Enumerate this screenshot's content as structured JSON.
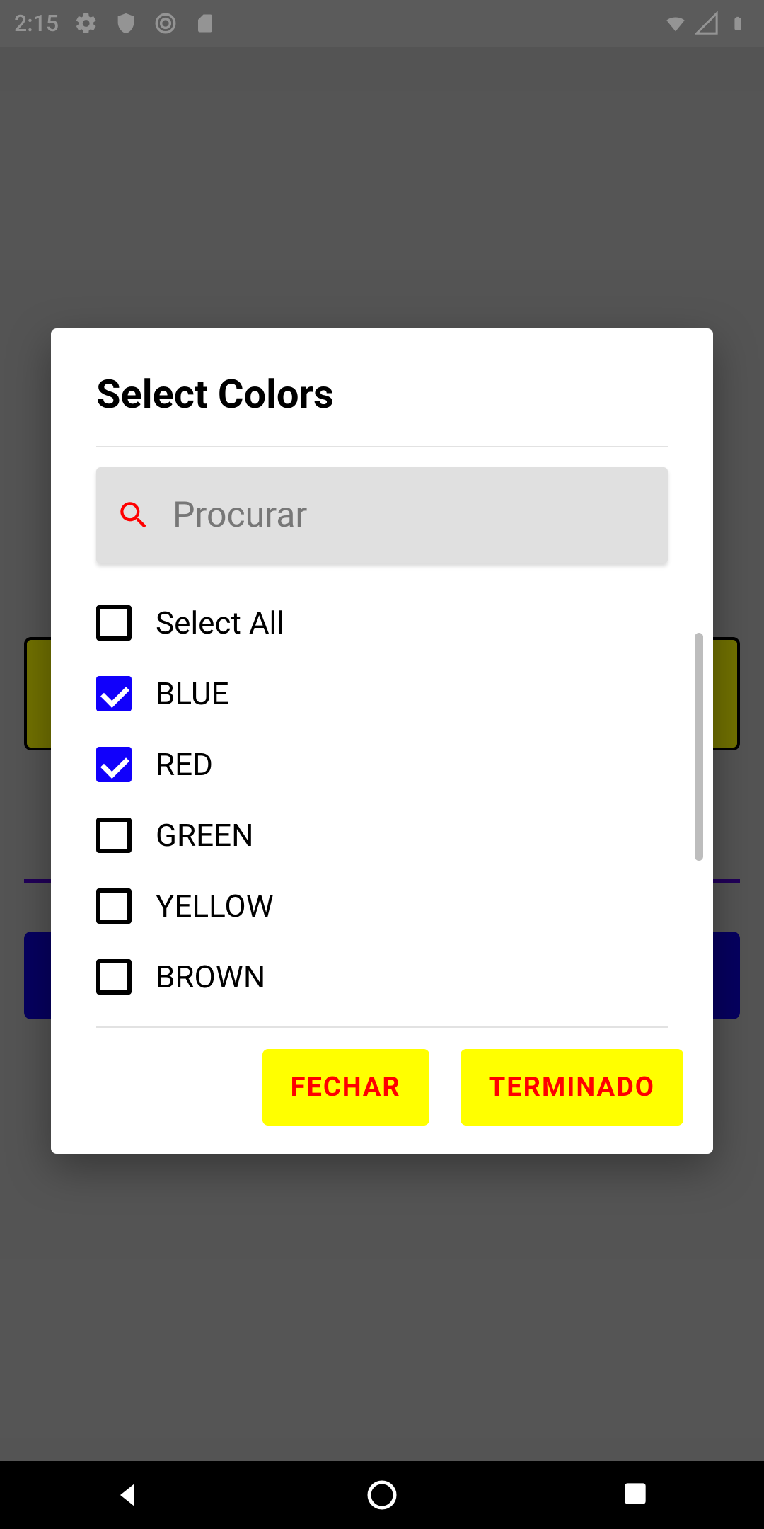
{
  "status": {
    "time": "2:15",
    "icons_left": [
      "gear-icon",
      "shield-icon",
      "sync-icon",
      "sd-card-icon"
    ],
    "icons_right": [
      "wifi-icon",
      "cell-signal-icon",
      "battery-icon"
    ]
  },
  "dialog": {
    "title": "Select Colors",
    "search_placeholder": "Procurar",
    "select_all_label": "Select All",
    "select_all_checked": false,
    "items": [
      {
        "label": "BLUE",
        "checked": true
      },
      {
        "label": "RED",
        "checked": true
      },
      {
        "label": "GREEN",
        "checked": false
      },
      {
        "label": "YELLOW",
        "checked": false
      },
      {
        "label": "BROWN",
        "checked": false
      }
    ],
    "close_label": "FECHAR",
    "done_label": "TERMINADO"
  },
  "colors": {
    "accent_checkbox": "#1100fb",
    "button_bg": "#ffff00",
    "button_text": "#ff0000",
    "search_icon": "#ff0000"
  }
}
